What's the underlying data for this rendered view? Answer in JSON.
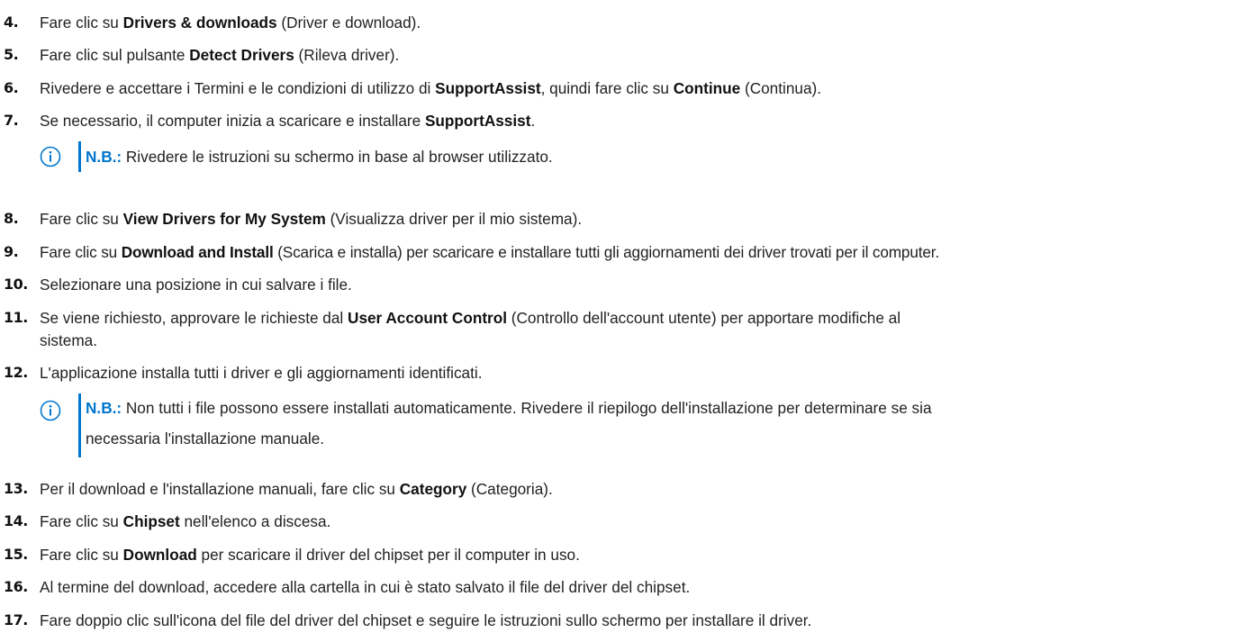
{
  "steps": [
    {
      "num": "4.",
      "pre": "Fare clic su ",
      "bold": "Drivers & downloads",
      "post": " (Driver e download)."
    },
    {
      "num": "5.",
      "pre": "Fare clic sul pulsante ",
      "bold": "Detect Drivers",
      "post": " (Rileva driver)."
    },
    {
      "num": "6.",
      "pre": "Rivedere e accettare i Termini e le condizioni di utilizzo di ",
      "bold": "SupportAssist",
      "mid": ", quindi fare clic su ",
      "bold2": "Continue",
      "post": " (Continua)."
    },
    {
      "num": "7.",
      "pre": "Se necessario, il computer inizia a scaricare e installare ",
      "bold": "SupportAssist",
      "post": "."
    },
    {
      "num": "8.",
      "pre": "Fare clic su ",
      "bold": "View Drivers for My System",
      "post": " (Visualizza driver per il mio sistema)."
    },
    {
      "num": "9.",
      "pre": "Fare clic su ",
      "bold": "Download and Install",
      "post": " (Scarica e installa) per scaricare e installare tutti gli aggiornamenti dei driver trovati per il computer."
    },
    {
      "num": "10.",
      "pre": "Selezionare una posizione in cui salvare i file."
    },
    {
      "num": "11.",
      "pre": "Se viene richiesto, approvare le richieste dal ",
      "bold": "User Account Control",
      "post": " (Controllo dell'account utente) per apportare modifiche al",
      "line2": "sistema."
    },
    {
      "num": "12.",
      "pre": "L'applicazione installa tutti i driver e gli aggiornamenti identificati."
    },
    {
      "num": "13.",
      "pre": "Per il download e l'installazione manuali, fare clic su ",
      "bold": "Category",
      "post": " (Categoria)."
    },
    {
      "num": "14.",
      "pre": "Fare clic su ",
      "bold": "Chipset",
      "post": " nell'elenco a discesa."
    },
    {
      "num": "15.",
      "pre": "Fare clic su ",
      "bold": "Download",
      "post": " per scaricare il driver del chipset per il computer in uso."
    },
    {
      "num": "16.",
      "pre": "Al termine del download, accedere alla cartella in cui è stato salvato il file del driver del chipset."
    },
    {
      "num": "17.",
      "pre": "Fare doppio clic sull'icona del file del driver del chipset e seguire le istruzioni sullo schermo per installare il driver."
    }
  ],
  "notes": [
    {
      "label": "N.B.:",
      "text": " Rivedere le istruzioni su schermo in base al browser utilizzato."
    },
    {
      "label": "N.B.:",
      "text": " Non tutti i file possono essere installati automaticamente. Rivedere il riepilogo dell'installazione per determinare se sia",
      "line2": "necessaria l'installazione manuale."
    }
  ],
  "colors": {
    "accent": "#0076ce",
    "text": "#222222"
  },
  "icons": {
    "note": "info-circle-icon"
  }
}
